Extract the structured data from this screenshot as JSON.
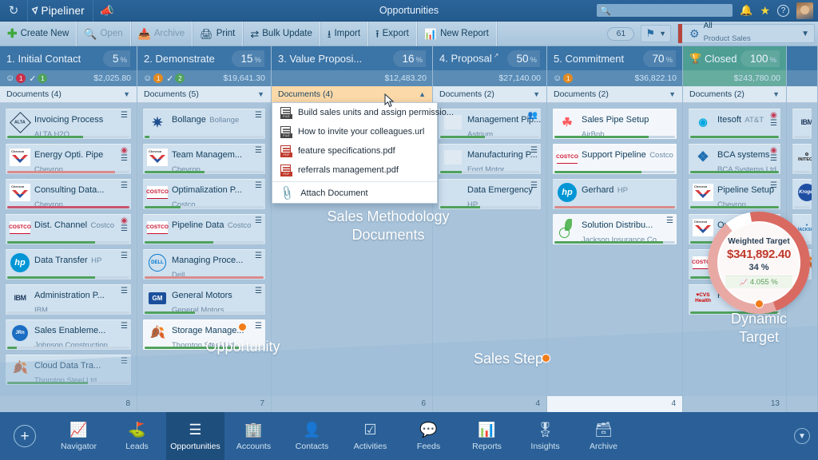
{
  "titlebar": {
    "brand": "Pipeliner",
    "title": "Opportunities",
    "refresh_icon": "refresh-icon",
    "megaphone_icon": "megaphone-icon",
    "search_placeholder": "",
    "search_value": "",
    "bell_icon": "bell-icon",
    "star_icon": "star-icon",
    "help_icon": "help-icon",
    "avatar_icon": "user-avatar"
  },
  "toolbar": {
    "buttons": [
      {
        "label": "Create New",
        "icon": "plus-icon",
        "dim": false
      },
      {
        "label": "Open",
        "icon": "magnifier-icon",
        "dim": true
      },
      {
        "label": "Archive",
        "icon": "archive-icon",
        "dim": true
      },
      {
        "label": "Print",
        "icon": "printer-icon",
        "dim": false
      },
      {
        "label": "Bulk Update",
        "icon": "bulk-update-icon",
        "dim": false
      },
      {
        "label": "Import",
        "icon": "import-icon",
        "dim": false
      },
      {
        "label": "Export",
        "icon": "export-csv-icon",
        "dim": false
      },
      {
        "label": "New Report",
        "icon": "new-report-icon",
        "dim": false
      }
    ],
    "record_count": "61",
    "flag_icon": "flag-icon",
    "filter_name": "All",
    "filter_sub": "Product Sales"
  },
  "pipeline": {
    "columns": [
      {
        "title": "1. Initial Contact",
        "percent": "5",
        "percent_symbol": "%",
        "amount": "$2,025.80",
        "documents_label": "Documents (4)",
        "badges": [
          {
            "icon": "task-icon",
            "count": "1",
            "color": "red"
          },
          {
            "icon": "check-icon",
            "count": "1",
            "color": "green"
          }
        ],
        "count": "8",
        "cards": [
          {
            "title": "Invoicing Process",
            "company": "ALTA H2O",
            "logo": "alta",
            "progress": 62,
            "progress_color": "#4fa25c",
            "target": false,
            "org": true,
            "white": false
          },
          {
            "title": "Energy Opti. Pipe",
            "company": "Chevron",
            "logo": "chevron",
            "progress": 88,
            "progress_color": "#d98b8b",
            "target": true,
            "org": true,
            "white": false
          },
          {
            "title": "Consulting Data...",
            "company": "Chevron",
            "logo": "chevron",
            "progress": 100,
            "progress_color": "#c9546e",
            "target": false,
            "org": true,
            "white": false
          },
          {
            "title": "Dist. Channel",
            "company": "Costco",
            "logo": "costco",
            "progress": 72,
            "progress_color": "#4fa25c",
            "target": true,
            "org": true,
            "white": false
          },
          {
            "title": "Data Transfer",
            "company": "HP",
            "logo": "hp",
            "progress": 72,
            "progress_color": "#4fa25c",
            "target": false,
            "org": true,
            "white": false
          },
          {
            "title": "Administration P...",
            "company": "IBM",
            "logo": "ibm",
            "progress": 0,
            "progress_color": "#4fa25c",
            "target": false,
            "org": true,
            "white": false
          },
          {
            "title": "Sales Enableme...",
            "company": "Johnson Construction",
            "logo": "jrn",
            "progress": 8,
            "progress_color": "#4fa25c",
            "target": false,
            "org": true,
            "white": false
          },
          {
            "title": "Cloud Data Tra...",
            "company": "Thornton Steel Ltd.",
            "logo": "leaf",
            "progress": 66,
            "progress_color": "#4fa25c",
            "target": false,
            "org": true,
            "white": false
          }
        ]
      },
      {
        "title": "2. Demonstrate",
        "percent": "15",
        "percent_symbol": "%",
        "amount": "$19,641.30",
        "documents_label": "Documents (5)",
        "badges": [
          {
            "icon": "task-icon",
            "count": "1",
            "color": "orange"
          },
          {
            "icon": "check-icon",
            "count": "2",
            "color": "green"
          }
        ],
        "count": "7",
        "cards": [
          {
            "title": "Bollange",
            "company": "Bollange",
            "logo": "bollange",
            "progress": 4,
            "progress_color": "#4fa25c",
            "target": false,
            "org": true,
            "white": false
          },
          {
            "title": "Team Managem...",
            "company": "Chevron",
            "logo": "chevron",
            "progress": 50,
            "progress_color": "#4fa25c",
            "target": false,
            "org": true,
            "white": false
          },
          {
            "title": "Optimalization P...",
            "company": "Costco",
            "logo": "costco",
            "progress": 30,
            "progress_color": "#4fa25c",
            "target": false,
            "org": true,
            "white": false
          },
          {
            "title": "Pipeline Data",
            "company": "Costco",
            "logo": "costco",
            "progress": 58,
            "progress_color": "#4fa25c",
            "target": false,
            "org": true,
            "white": false
          },
          {
            "title": "Managing Proce...",
            "company": "Dell",
            "logo": "dell",
            "progress": 100,
            "progress_color": "#d98b8b",
            "target": false,
            "org": true,
            "white": false
          },
          {
            "title": "General Motors",
            "company": "General Motors",
            "logo": "gm",
            "progress": 42,
            "progress_color": "#4fa25c",
            "target": false,
            "org": true,
            "white": false
          },
          {
            "title": "Storage Manage...",
            "company": "Thornton Steel Ltd.",
            "logo": "leaf",
            "progress": 80,
            "progress_color": "#4fa25c",
            "target": false,
            "org": true,
            "white": true
          }
        ]
      },
      {
        "title": "3. Value Proposi...",
        "percent": "16",
        "percent_symbol": "%",
        "amount": "$12,483.20",
        "documents_label": "Documents (4)",
        "documents_open": true,
        "badges": [],
        "count": "6",
        "cards": []
      },
      {
        "title": "4. Proposal",
        "percent": "50",
        "percent_symbol": "%",
        "amount": "$27,140.00",
        "documents_label": "Documents (2)",
        "external_link": true,
        "badges": [],
        "count": "4",
        "cards": [
          {
            "title": "Management Pip...",
            "company": "Astrium",
            "logo": "astrium",
            "progress": 45,
            "progress_color": "#4fa25c",
            "target": false,
            "org": "person",
            "white": false
          },
          {
            "title": "Manufacturing P...",
            "company": "Ford Motor",
            "logo": "ford",
            "progress": 22,
            "progress_color": "#4fa25c",
            "target": false,
            "org": true,
            "white": false
          },
          {
            "title": "Data Emergency",
            "company": "HP",
            "logo": "none",
            "progress": 40,
            "progress_color": "#4fa25c",
            "target": false,
            "org": true,
            "white": false
          }
        ]
      },
      {
        "title": "5. Commitment",
        "percent": "70",
        "percent_symbol": "%",
        "amount": "$36,822.10",
        "documents_label": "Documents (2)",
        "badges": [
          {
            "icon": "task-icon",
            "count": "1",
            "color": "orange"
          }
        ],
        "count": "4",
        "cards": [
          {
            "title": "Sales Pipe Setup",
            "company": "AirBnb",
            "logo": "airbnb",
            "progress": 78,
            "progress_color": "#4fa25c",
            "target": false,
            "org": false,
            "white": true
          },
          {
            "title": "Support Pipeline",
            "company": "Costco",
            "logo": "costco",
            "progress": 72,
            "progress_color": "#4fa25c",
            "target": false,
            "org": false,
            "white": true
          },
          {
            "title": "Gerhard",
            "company": "HP",
            "logo": "hp",
            "progress": 100,
            "progress_color": "#d98b8b",
            "target": false,
            "org": false,
            "white": false
          },
          {
            "title": "Solution Distribu...",
            "company": "Jackson Insurance Co...",
            "logo": "jackson",
            "progress": 90,
            "progress_color": "#4fa25c",
            "target": false,
            "org": true,
            "white": true
          }
        ]
      },
      {
        "title": "Closed",
        "percent": "100",
        "percent_symbol": "%",
        "amount": "$243,780.00",
        "documents_label": "Documents (2)",
        "trophy": true,
        "closed": true,
        "badges": [],
        "count": "13",
        "cards": [
          {
            "title": "Itesoft",
            "company": "AT&T",
            "logo": "att",
            "progress": 100,
            "progress_color": "#4fa25c",
            "target": true,
            "org": true,
            "white": false
          },
          {
            "title": "BCA systems",
            "company": "BCA Systems Ltd.",
            "logo": "bca",
            "progress": 100,
            "progress_color": "#4fa25c",
            "target": true,
            "org": true,
            "white": false
          },
          {
            "title": "Pipeline Setup",
            "company": "Chevron",
            "logo": "chevron",
            "progress": 100,
            "progress_color": "#4fa25c",
            "target": false,
            "org": true,
            "white": false
          },
          {
            "title": "Output...",
            "company": "Ch...",
            "logo": "chevron",
            "progress": 100,
            "progress_color": "#4fa25c",
            "target": false,
            "org": false,
            "white": false
          },
          {
            "title": "",
            "company": "",
            "logo": "costco",
            "progress": 100,
            "progress_color": "#4fa25c",
            "target": false,
            "org": false,
            "white": false
          },
          {
            "title": "F...",
            "company": "CVS...",
            "logo": "cvs",
            "progress": 100,
            "progress_color": "#4fa25c",
            "target": false,
            "org": false,
            "white": false
          }
        ]
      },
      {
        "title": "",
        "percent": "",
        "percent_symbol": "",
        "amount": "",
        "documents_label": "",
        "partial": true,
        "badges": [],
        "count": "",
        "cards": [
          {
            "title": "",
            "company": "",
            "logo": "ibm",
            "progress": 0,
            "progress_color": "#4fa25c",
            "target": false,
            "org": false,
            "white": false
          },
          {
            "title": "",
            "company": "",
            "logo": "initech",
            "progress": 0,
            "progress_color": "#4fa25c",
            "target": false,
            "org": false,
            "white": false
          },
          {
            "title": "",
            "company": "",
            "logo": "kroger",
            "progress": 0,
            "progress_color": "#4fa25c",
            "target": false,
            "org": false,
            "white": false
          },
          {
            "title": "",
            "company": "",
            "logo": "jic",
            "progress": 0,
            "progress_color": "#4fa25c",
            "target": false,
            "org": false,
            "white": false
          },
          {
            "title": "",
            "company": "",
            "logo": "leaf",
            "progress": 0,
            "progress_color": "#4fa25c",
            "target": false,
            "org": false,
            "white": false
          }
        ]
      }
    ]
  },
  "documents_menu": {
    "items": [
      {
        "label": "Build sales units and assign permissio...",
        "type": "file"
      },
      {
        "label": "How to invite your colleagues.url",
        "type": "file"
      },
      {
        "label": "feature specifications.pdf",
        "type": "pdf"
      },
      {
        "label": "referrals management.pdf",
        "type": "pdf"
      }
    ],
    "attach_label": "Attach Document",
    "attach_icon": "paperclip-icon"
  },
  "dial": {
    "label": "Weighted Target",
    "value": "$341,892.40",
    "percent": "34 %",
    "trend": "4.055 %",
    "trend_icon": "bar-chart-icon"
  },
  "annotations": [
    {
      "text": "Sales Methodology\nDocuments",
      "key": "sales-methodology-documents"
    },
    {
      "text": "Opportunity",
      "key": "opportunity"
    },
    {
      "text": "Sales Step",
      "key": "sales-step"
    },
    {
      "text": "Dynamic\nTarget",
      "key": "dynamic-target"
    }
  ],
  "bottomnav": {
    "add_label": "+",
    "items": [
      {
        "label": "Navigator",
        "icon": "navigator-icon",
        "active": false
      },
      {
        "label": "Leads",
        "icon": "leads-icon",
        "active": false
      },
      {
        "label": "Opportunities",
        "icon": "opportunities-icon",
        "active": true
      },
      {
        "label": "Accounts",
        "icon": "accounts-icon",
        "active": false
      },
      {
        "label": "Contacts",
        "icon": "contacts-icon",
        "active": false
      },
      {
        "label": "Activities",
        "icon": "activities-icon",
        "active": false
      },
      {
        "label": "Feeds",
        "icon": "feeds-icon",
        "active": false
      },
      {
        "label": "Reports",
        "icon": "reports-icon",
        "active": false
      },
      {
        "label": "Insights",
        "icon": "insights-icon",
        "active": false
      },
      {
        "label": "Archive",
        "icon": "archive-nav-icon",
        "active": false
      }
    ],
    "collapse_icon": "chevron-down-icon"
  },
  "colors": {
    "brand_blue": "#2a6097",
    "header_blue": "#3b74a6",
    "closed_teal": "#4e9e93",
    "accent_orange": "#f07d1a",
    "target_red": "#c0392b",
    "progress_green": "#4fa25c"
  }
}
